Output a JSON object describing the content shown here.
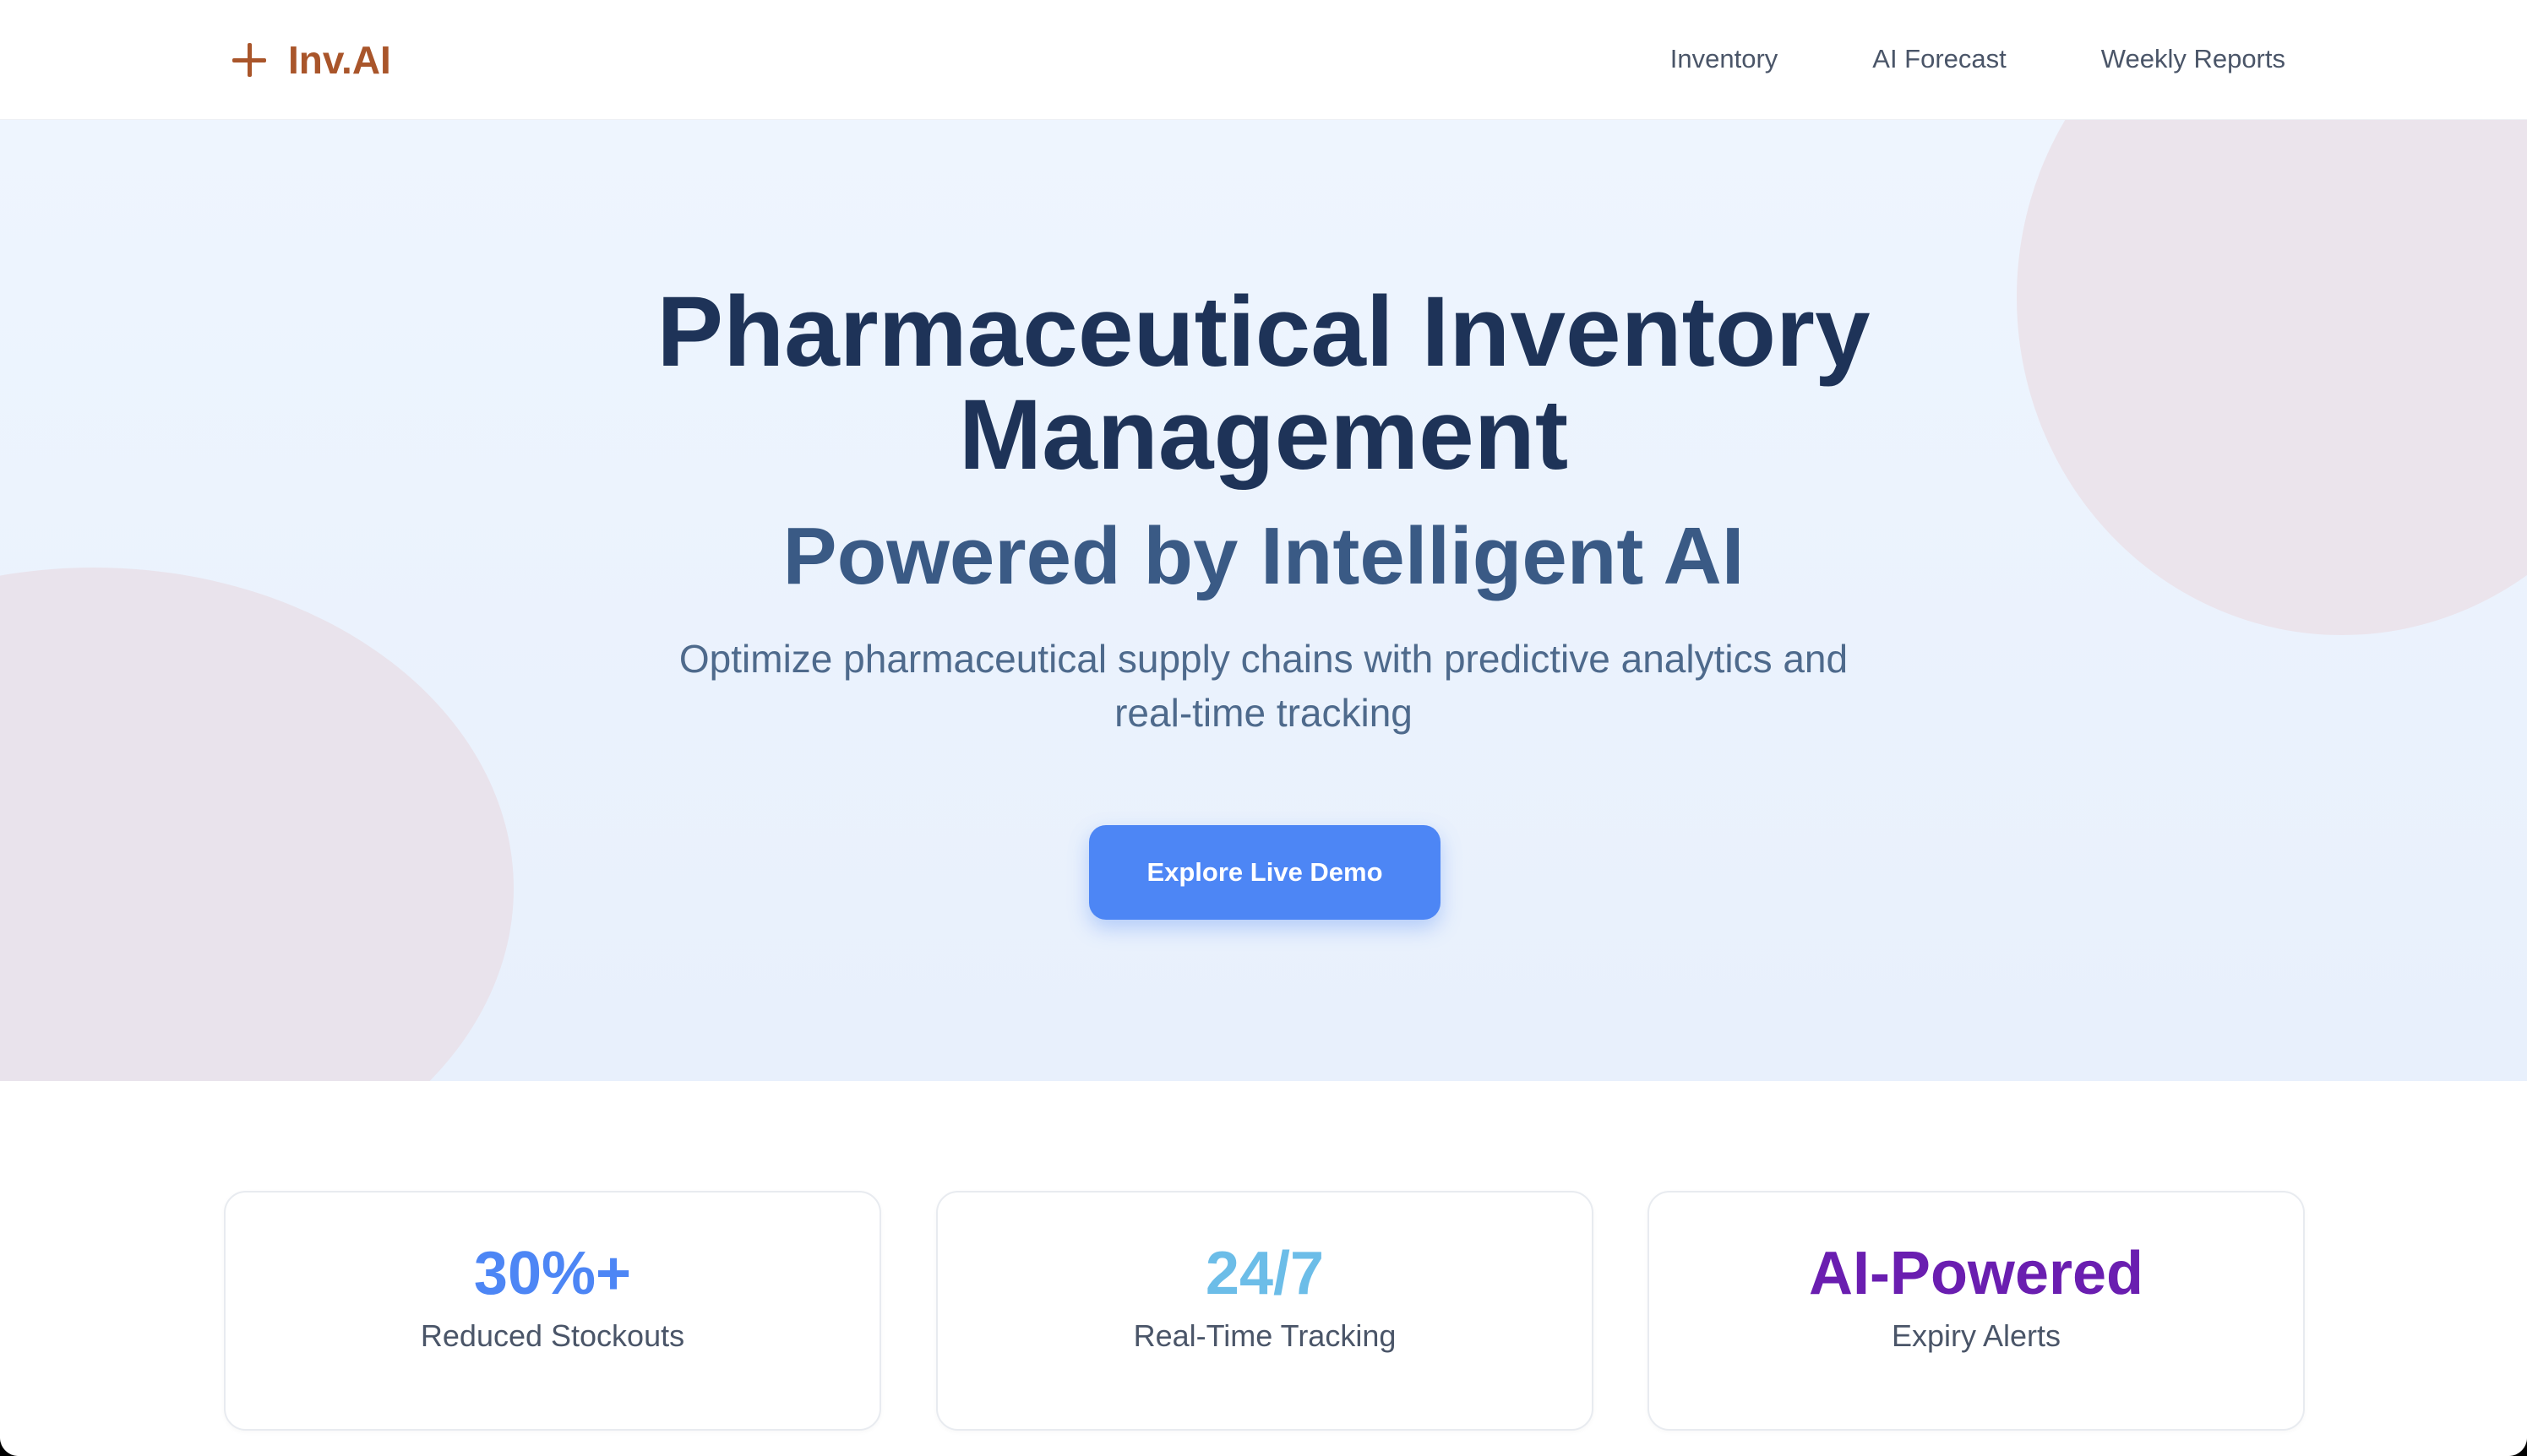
{
  "nav": {
    "brand": "Inv.AI",
    "links": [
      "Inventory",
      "AI Forecast",
      "Weekly Reports"
    ]
  },
  "hero": {
    "title_line1": "Pharmaceutical Inventory",
    "title_line2": "Management",
    "subtitle": "Powered by Intelligent AI",
    "description_line1": "Optimize pharmaceutical supply chains with predictive analytics and",
    "description_line2": "real-time tracking",
    "cta_label": "Explore Live Demo"
  },
  "stats": [
    {
      "value": "30%+",
      "label": "Reduced Stockouts",
      "color": "#4d86f5"
    },
    {
      "value": "24/7",
      "label": "Real-Time Tracking",
      "color": "#6cbde8"
    },
    {
      "value": "AI-Powered",
      "label": "Expiry Alerts",
      "color": "#6a1eb0"
    }
  ],
  "colors": {
    "brand": "#a9552a",
    "heading": "#1e3358",
    "accent": "#4d86f5"
  },
  "icons": {
    "brand_icon": "plus-icon"
  }
}
